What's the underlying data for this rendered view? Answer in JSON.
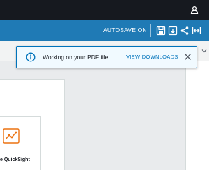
{
  "header": {
    "user_icon": "user-icon"
  },
  "toolbar": {
    "autosave_label": "AUTOSAVE ON",
    "icons": [
      "save-icon",
      "download-icon",
      "share-icon",
      "fit-width-icon"
    ]
  },
  "notification": {
    "message": "Working on your PDF file.",
    "action_label": "VIEW DOWNLOADS",
    "icon": "info-icon",
    "close_icon": "close-icon"
  },
  "canvas": {
    "visual_label": "e QuickSight"
  },
  "colors": {
    "top_bar": "#16191f",
    "toolbar": "#1f7ab5",
    "notification_bg": "#f1faff",
    "notification_border": "#0073bb",
    "accent": "#0073bb",
    "chart_icon": "#ec7211",
    "workspace_bg": "#e9ebed"
  }
}
